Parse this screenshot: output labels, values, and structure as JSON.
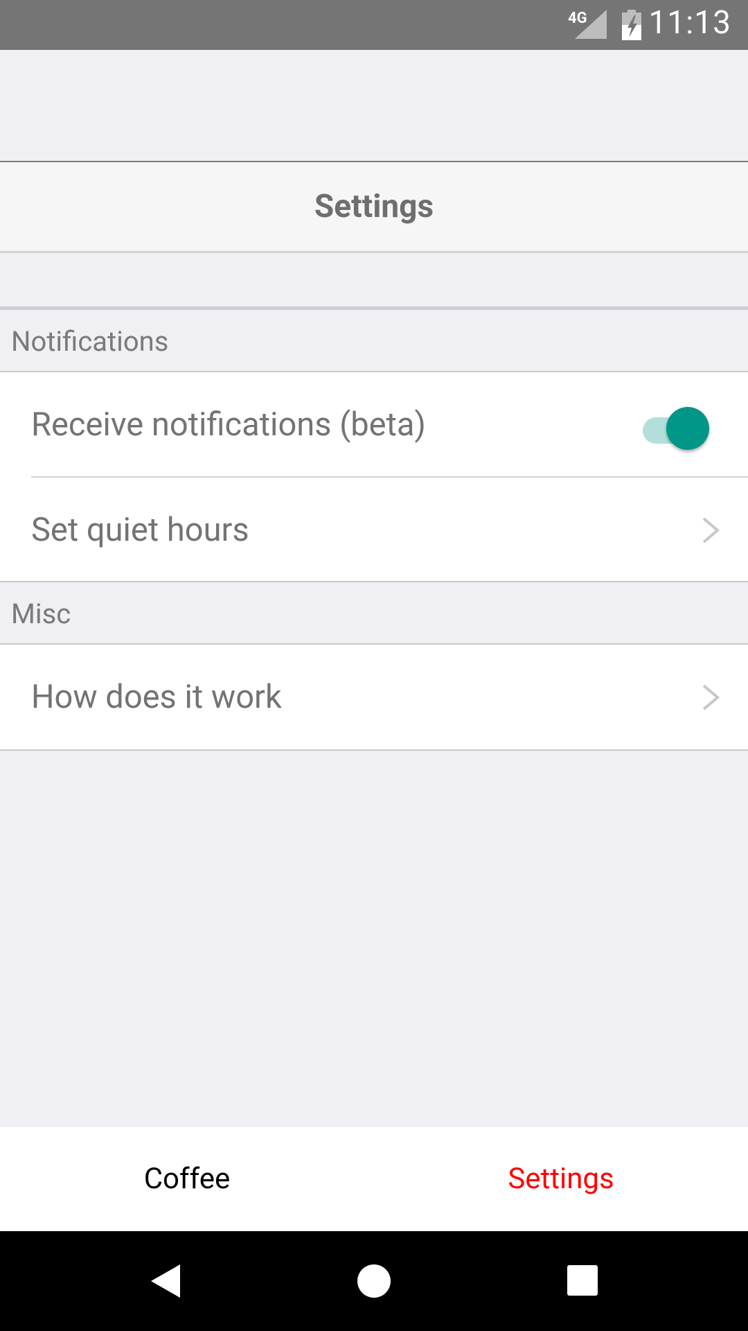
{
  "status_bar": {
    "network": "4G",
    "time": "11:13",
    "icons": [
      "signal-icon",
      "battery-charging-icon"
    ]
  },
  "nav": {
    "title": "Settings"
  },
  "sections": {
    "notifications": {
      "header": "Notifications",
      "receive_label": "Receive notifications (beta)",
      "receive_enabled": true,
      "quiet_hours_label": "Set quiet hours"
    },
    "misc": {
      "header": "Misc",
      "how_it_works_label": "How does it work"
    }
  },
  "tabs": {
    "coffee": "Coffee",
    "settings": "Settings",
    "active": "settings"
  },
  "colors": {
    "accent_toggle": "#009688",
    "active_tab": "#ff0000",
    "status_bar": "#757575"
  },
  "system_nav": {
    "icons": [
      "back-icon",
      "home-icon",
      "recents-icon"
    ]
  }
}
